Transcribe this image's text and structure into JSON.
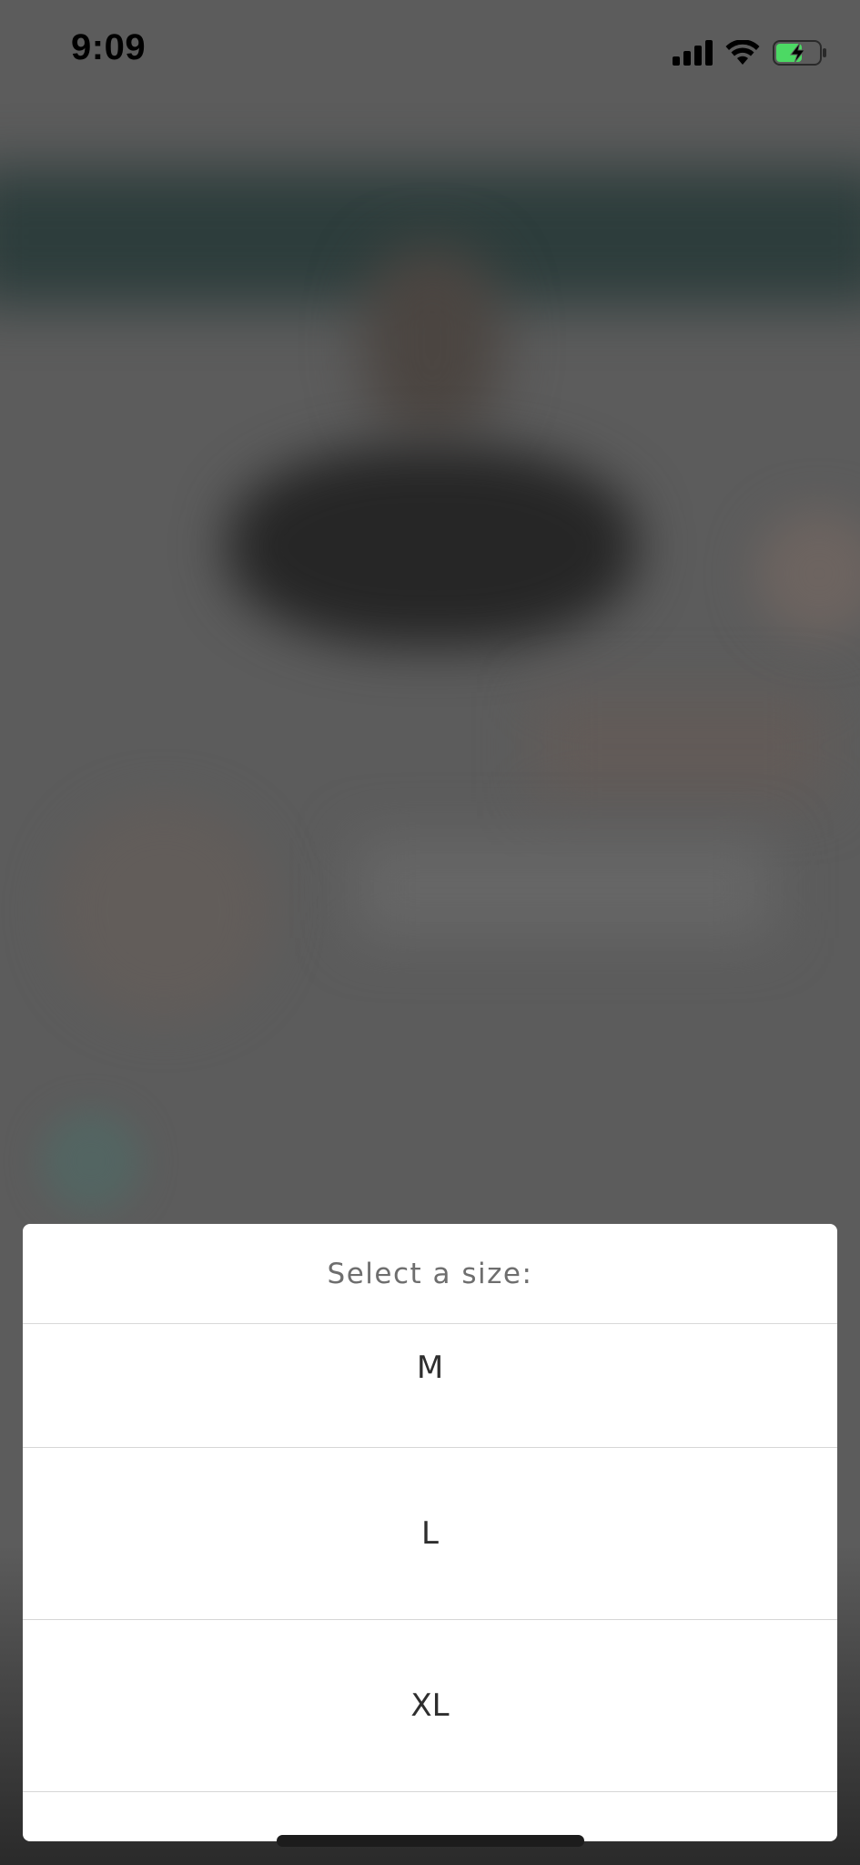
{
  "status_bar": {
    "time": "9:09",
    "icons": [
      "cellular-signal-icon",
      "wifi-icon",
      "battery-charging-icon"
    ],
    "battery_color": "#4cd964"
  },
  "size_picker": {
    "title": "Select a size:",
    "options": [
      {
        "label": "M"
      },
      {
        "label": "L"
      },
      {
        "label": "XL"
      }
    ]
  }
}
